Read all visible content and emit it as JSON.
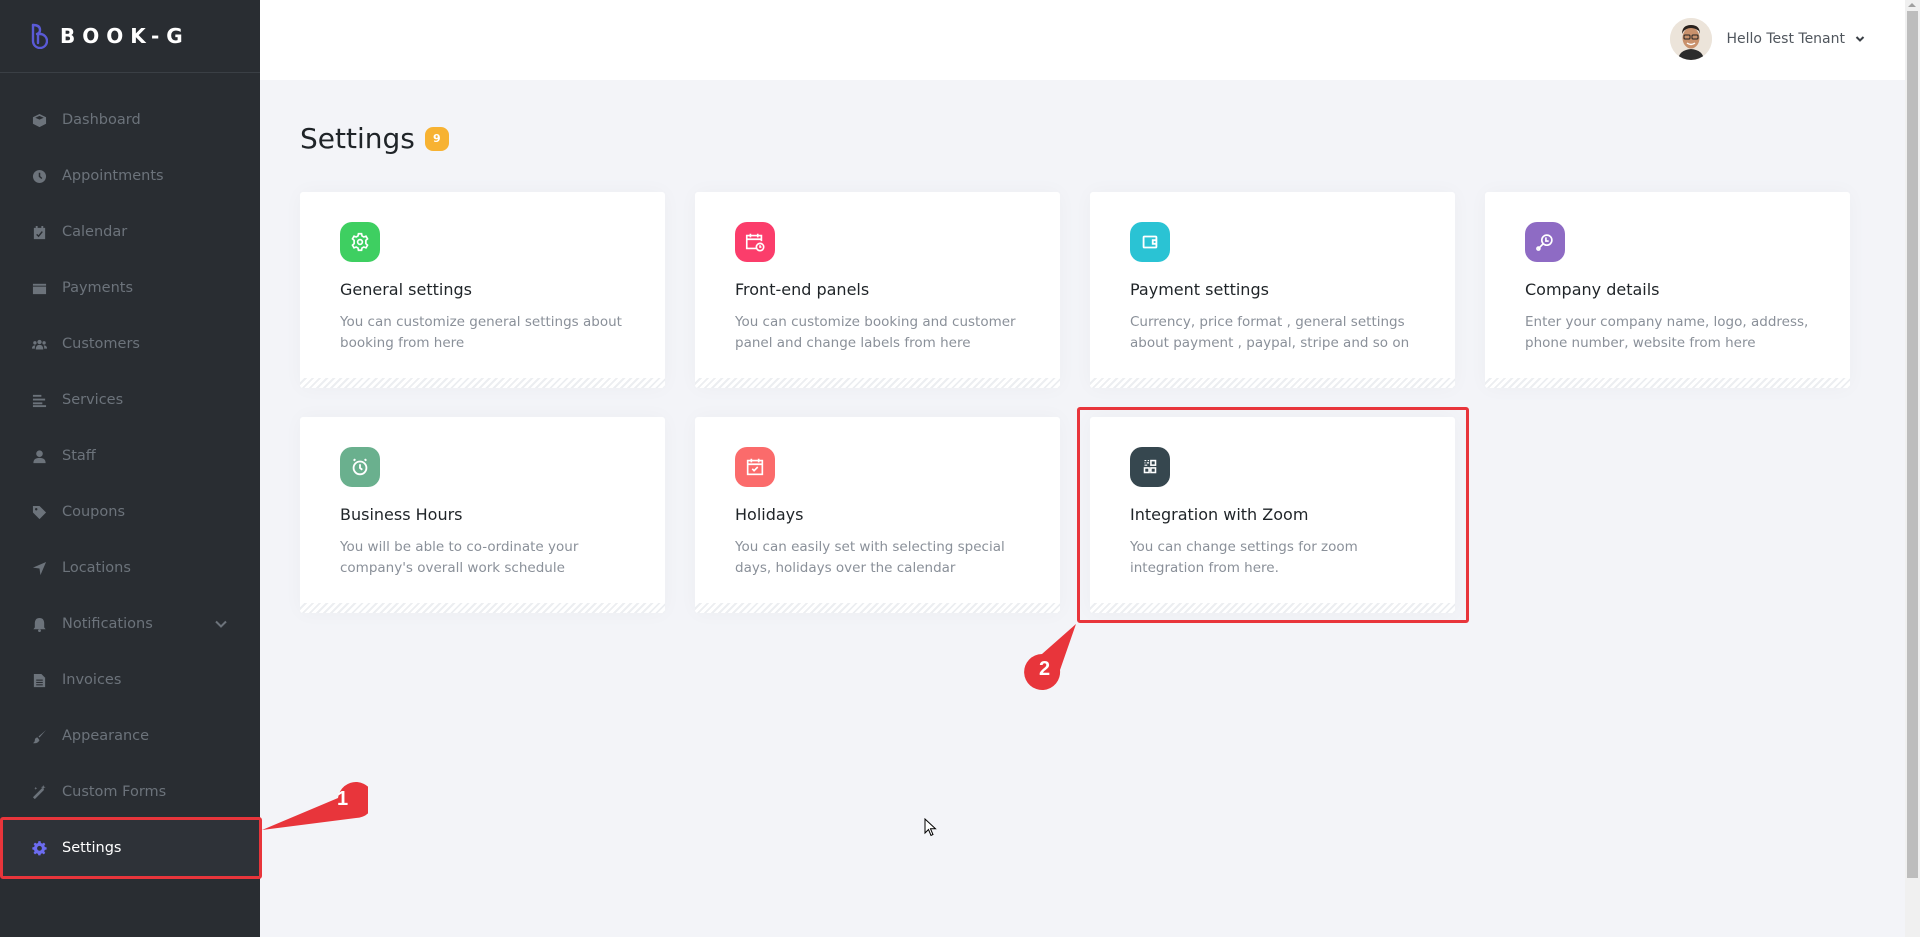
{
  "brand": {
    "name": "BOOK-G",
    "accent": "#6c6cf0"
  },
  "sidebar": {
    "items": [
      {
        "label": "Dashboard",
        "icon": "cube-icon"
      },
      {
        "label": "Appointments",
        "icon": "clock-icon"
      },
      {
        "label": "Calendar",
        "icon": "calendar-check-icon"
      },
      {
        "label": "Payments",
        "icon": "wallet-icon"
      },
      {
        "label": "Customers",
        "icon": "users-icon"
      },
      {
        "label": "Services",
        "icon": "list-icon"
      },
      {
        "label": "Staff",
        "icon": "user-icon"
      },
      {
        "label": "Coupons",
        "icon": "tag-icon"
      },
      {
        "label": "Locations",
        "icon": "location-arrow-icon"
      },
      {
        "label": "Notifications",
        "icon": "bell-icon",
        "expandable": true
      },
      {
        "label": "Invoices",
        "icon": "file-icon"
      },
      {
        "label": "Appearance",
        "icon": "brush-icon"
      },
      {
        "label": "Custom Forms",
        "icon": "magic-wand-icon"
      },
      {
        "label": "Settings",
        "icon": "gear-icon",
        "active": true
      }
    ]
  },
  "topbar": {
    "greeting": "Hello Test Tenant"
  },
  "page": {
    "title": "Settings",
    "count": "9"
  },
  "cards": [
    {
      "title": "General settings",
      "desc": "You can customize general settings about booking from here",
      "icon": "gear-icon",
      "color": "#3ecf61"
    },
    {
      "title": "Front-end panels",
      "desc": "You can customize booking and customer panel and change labels from here",
      "icon": "calendar-clock-icon",
      "color": "#fb3d6b"
    },
    {
      "title": "Payment settings",
      "desc": "Currency, price format , general settings about payment , paypal, stripe and so on",
      "icon": "wallet-icon",
      "color": "#2ac3d4"
    },
    {
      "title": "Company details",
      "desc": "Enter your company name, logo, address, phone number, website from here",
      "icon": "key-icon",
      "color": "#8e6bc4"
    },
    {
      "title": "Business Hours",
      "desc": "You will be able to co-ordinate your company's overall work schedule",
      "icon": "alarm-clock-icon",
      "color": "#6ab08e"
    },
    {
      "title": "Holidays",
      "desc": "You can easily set with selecting special days, holidays over the calendar",
      "icon": "calendar-check-icon",
      "color": "#fb6b6b"
    },
    {
      "title": "Integration with Zoom",
      "desc": "You can change settings for zoom integration from here.",
      "icon": "qr-code-icon",
      "color": "#36474f"
    }
  ],
  "annotations": {
    "step1": "1",
    "step2": "2",
    "color": "#e8353b"
  }
}
